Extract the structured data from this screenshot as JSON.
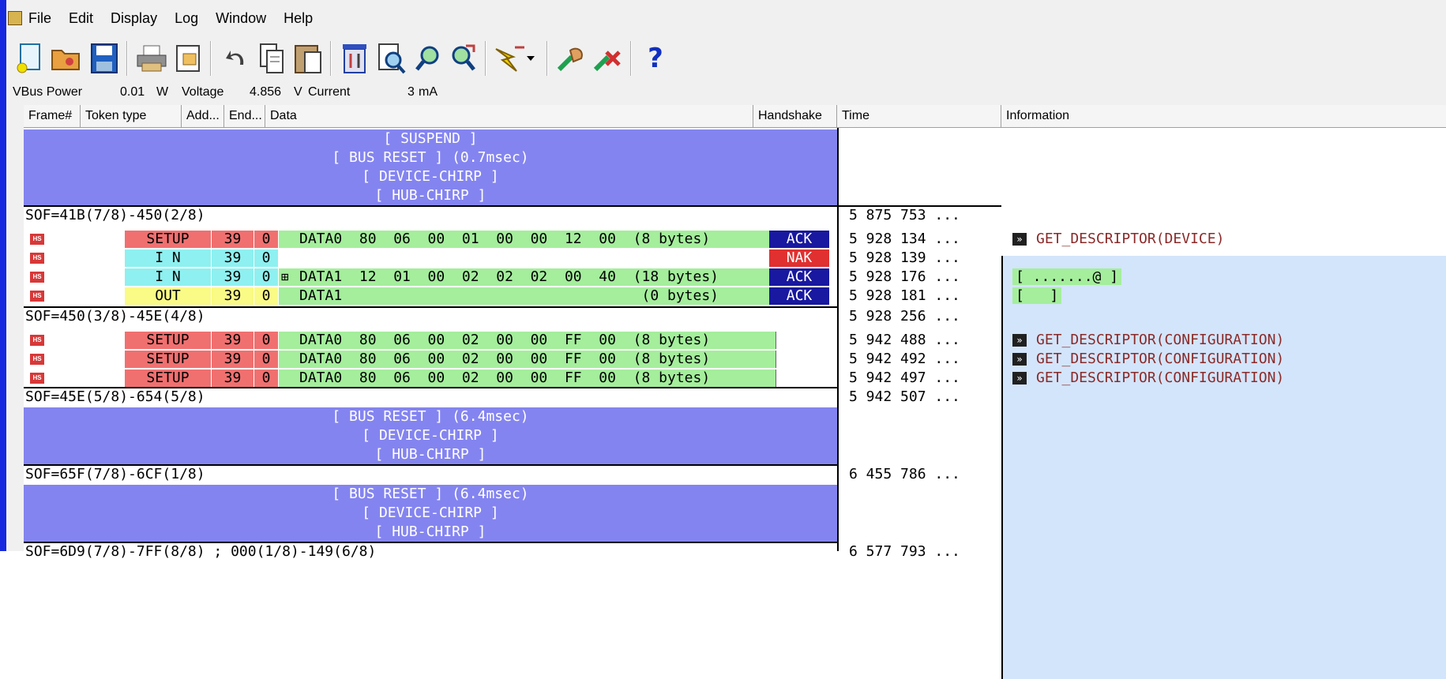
{
  "menu": [
    "File",
    "Edit",
    "Display",
    "Log",
    "Window",
    "Help"
  ],
  "toolbar": {
    "icons": [
      "new-file-icon",
      "open-folder-icon",
      "save-icon",
      "print-icon",
      "print-preview-icon",
      "undo-icon",
      "copy-icon",
      "paste-icon",
      "settings-icon",
      "search-icon",
      "find-next-icon",
      "find-prev-icon",
      "trigger-icon",
      "record-icon",
      "stop-icon",
      "help-icon"
    ],
    "help_glyph": "?"
  },
  "vbus": {
    "label": "VBus Power",
    "power": "0.01",
    "power_unit": "W",
    "voltage_label": "Voltage",
    "voltage": "4.856",
    "voltage_unit": "V",
    "current_label": "Current",
    "current": "3",
    "current_unit": "mA"
  },
  "columns": [
    "Frame#",
    "Token type",
    "Add...",
    "End...",
    "Data",
    "Handshake",
    "Time",
    "Information"
  ],
  "rows": {
    "suspend": "[ SUSPEND ]",
    "bus_reset_1": "[ BUS RESET ] (0.7msec)",
    "device_chirp_1": "[ DEVICE-CHIRP ]",
    "hub_chirp_1": "[ HUB-CHIRP ]",
    "sof_1": "SOF=41B(7/8)-450(2/8)",
    "time_sof_1": "5 875 753 ...",
    "p1": {
      "token": "SETUP",
      "addr": "39",
      "end": "0",
      "data": "DATA0  80  06  00  01  00  00  12  00  (8 bytes)",
      "hs": "ACK",
      "time": "5 928 134 ...",
      "info": "GET_DESCRIPTOR(DEVICE)"
    },
    "p2": {
      "token": "I N",
      "addr": "39",
      "end": "0",
      "hs": "NAK",
      "time": "5 928 139 ..."
    },
    "p3": {
      "token": "I N",
      "addr": "39",
      "end": "0",
      "expand": "⊞",
      "data": "DATA1  12  01  00  02  02  02  00  40  (18 bytes)",
      "hs": "ACK",
      "time": "5 928 176 ...",
      "info": "[ .......@ ]"
    },
    "p4": {
      "token": "OUT",
      "addr": "39",
      "end": "0",
      "data": "DATA1                                   (0 bytes)",
      "hs": "ACK",
      "time": "5 928 181 ...",
      "info": "[   ]"
    },
    "sof_2": "SOF=450(3/8)-45E(4/8)",
    "time_sof_2": "5 928 256 ...",
    "p5": {
      "token": "SETUP",
      "addr": "39",
      "end": "0",
      "data": "DATA0  80  06  00  02  00  00  FF  00  (8 bytes)",
      "time": "5 942 488 ...",
      "info": "GET_DESCRIPTOR(CONFIGURATION)"
    },
    "p6": {
      "token": "SETUP",
      "addr": "39",
      "end": "0",
      "data": "DATA0  80  06  00  02  00  00  FF  00  (8 bytes)",
      "time": "5 942 492 ...",
      "info": "GET_DESCRIPTOR(CONFIGURATION)"
    },
    "p7": {
      "token": "SETUP",
      "addr": "39",
      "end": "0",
      "data": "DATA0  80  06  00  02  00  00  FF  00  (8 bytes)",
      "time": "5 942 497 ...",
      "info": "GET_DESCRIPTOR(CONFIGURATION)"
    },
    "sof_3": "SOF=45E(5/8)-654(5/8)",
    "time_sof_3": "5 942 507 ...",
    "bus_reset_2": "[ BUS RESET ] (6.4msec)",
    "device_chirp_2": "[ DEVICE-CHIRP ]",
    "hub_chirp_2": "[ HUB-CHIRP ]",
    "sof_4": "SOF=65F(7/8)-6CF(1/8)",
    "time_sof_4": "6 455 786 ...",
    "bus_reset_3": "[ BUS RESET ] (6.4msec)",
    "device_chirp_3": "[ DEVICE-CHIRP ]",
    "hub_chirp_3": "[ HUB-CHIRP ]",
    "sof_5": "SOF=6D9(7/8)-7FF(8/8) ; 000(1/8)-149(6/8)",
    "time_sof_5": "6 577 793 ..."
  },
  "hs_badge": "HS",
  "arrow_glyph": "»"
}
